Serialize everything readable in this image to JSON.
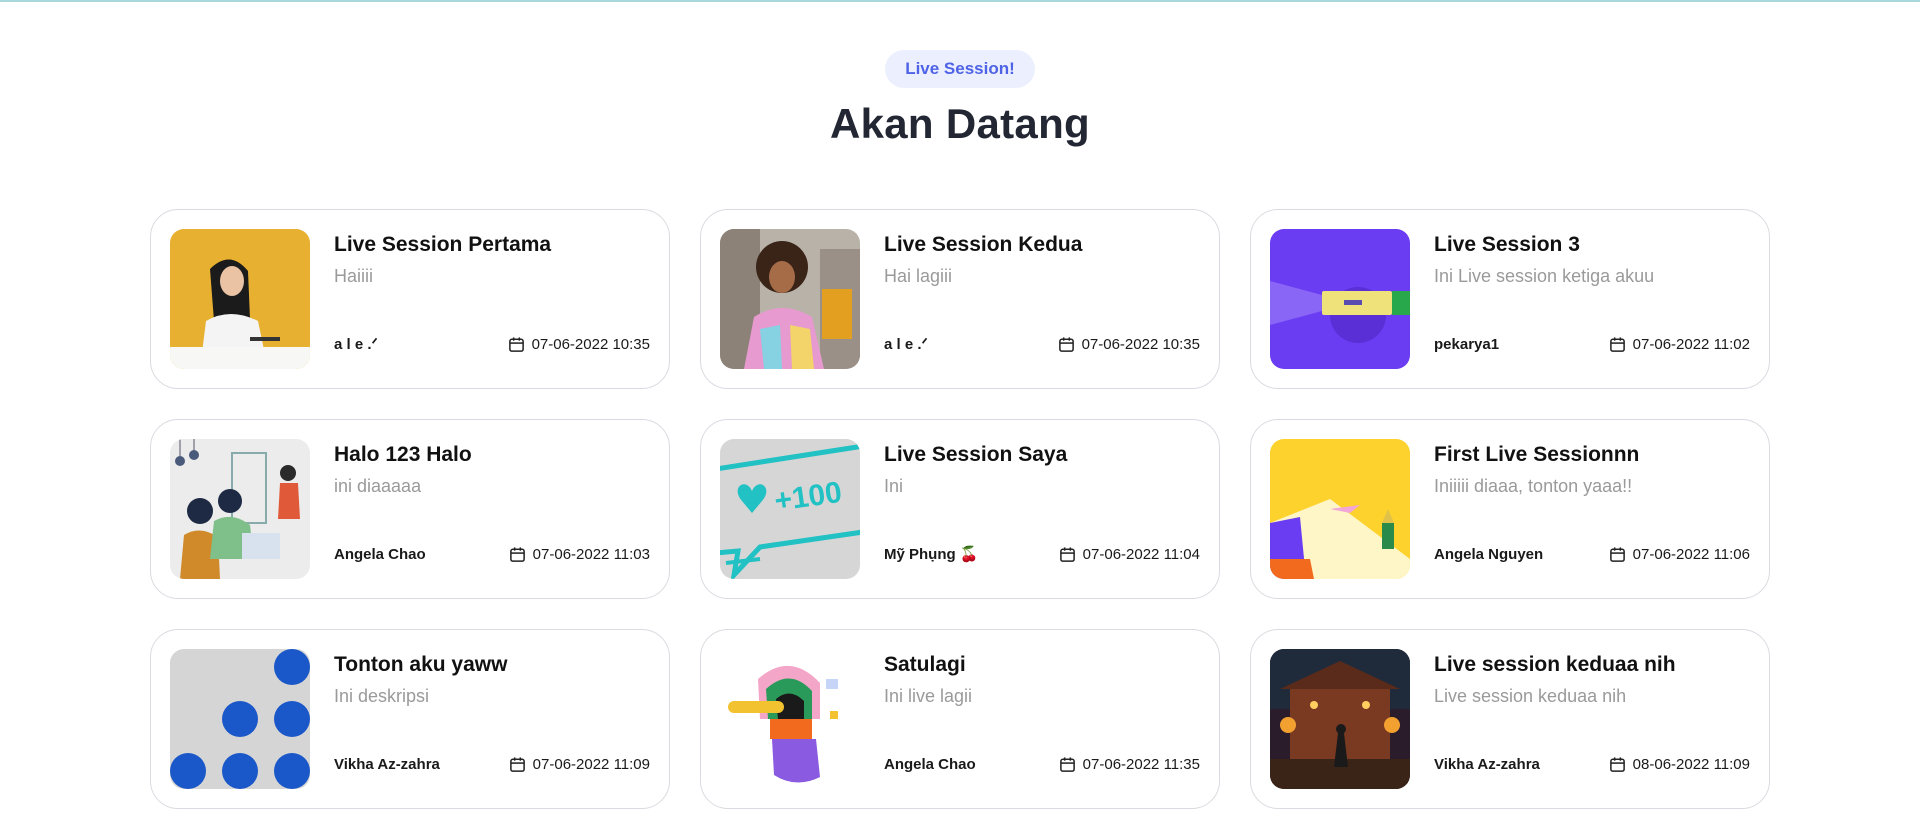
{
  "header": {
    "badge": "Live Session!",
    "title": "Akan Datang"
  },
  "colors": {
    "badge_bg": "#eceffe",
    "badge_text": "#4f63e7",
    "card_border": "#d9dbe0"
  },
  "sessions": [
    {
      "title": "Live Session Pertama",
      "description": "Haiiii",
      "author": "a l e .ᐟ",
      "date": "07-06-2022 10:35"
    },
    {
      "title": "Live Session Kedua",
      "description": "Hai lagiii",
      "author": "a l e .ᐟ",
      "date": "07-06-2022 10:35"
    },
    {
      "title": "Live Session 3",
      "description": "Ini Live session ketiga akuu",
      "author": "pekarya1",
      "date": "07-06-2022 11:02"
    },
    {
      "title": "Halo 123 Halo",
      "description": "ini diaaaaa",
      "author": "Angela Chao",
      "date": "07-06-2022 11:03"
    },
    {
      "title": "Live Session Saya",
      "description": "Ini",
      "author": "Mỹ Phụng 🍒",
      "date": "07-06-2022 11:04"
    },
    {
      "title": "First Live Sessionnn",
      "description": "Iniiiii diaaa, tonton yaaa!!",
      "author": "Angela Nguyen",
      "date": "07-06-2022 11:06"
    },
    {
      "title": "Tonton aku yaww",
      "description": "Ini deskripsi",
      "author": "Vikha Az-zahra",
      "date": "07-06-2022 11:09"
    },
    {
      "title": "Satulagi",
      "description": "Ini live lagii",
      "author": "Angela Chao",
      "date": "07-06-2022 11:35"
    },
    {
      "title": "Live session keduaa nih",
      "description": "Live session keduaa nih",
      "author": "Vikha Az-zahra",
      "date": "08-06-2022 11:09"
    }
  ],
  "thumbnail_icons": [
    "woman-writing-image",
    "woman-street-image",
    "purple-illustration-image",
    "office-illustration-image",
    "like-counter-image",
    "yellow-illustration-image",
    "blue-dots-image",
    "abstract-head-image",
    "night-festival-image"
  ],
  "thumbnail_labels": [
    "+100"
  ]
}
